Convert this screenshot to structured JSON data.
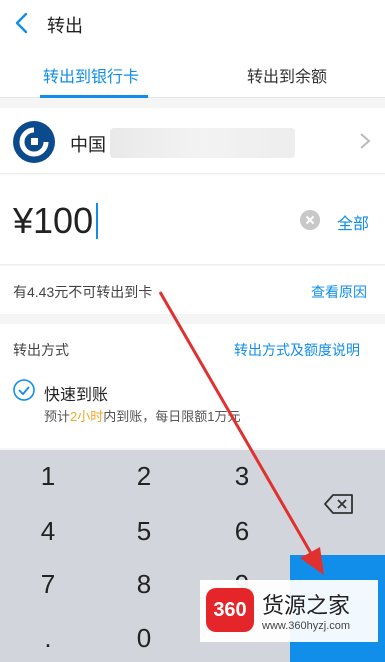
{
  "header": {
    "title": "转出"
  },
  "tabs": [
    {
      "label": "转出到银行卡",
      "active": true
    },
    {
      "label": "转出到余额",
      "active": false
    }
  ],
  "bank": {
    "name": "中国",
    "logo_icon": "ccb-bank-logo"
  },
  "amount": {
    "currency": "¥",
    "value": "100",
    "all_label": "全部"
  },
  "notice": {
    "text": "有4.43元不可转出到卡",
    "link": "查看原因"
  },
  "method": {
    "label": "转出方式",
    "link": "转出方式及额度说明",
    "option_title": "快速到账",
    "desc_pre": "预计",
    "desc_highlight": "2小时",
    "desc_post": "内到账，每日限额1万元"
  },
  "keypad": {
    "keys": [
      "1",
      "2",
      "3",
      "4",
      "5",
      "6",
      "7",
      "8",
      "9",
      ".",
      "0"
    ]
  },
  "watermark": {
    "badge": "360",
    "name": "货源之家",
    "url": "www.360hyzj.com"
  },
  "colors": {
    "accent": "#108ee9",
    "highlight": "#f5a623",
    "arrow": "#e0302f"
  }
}
